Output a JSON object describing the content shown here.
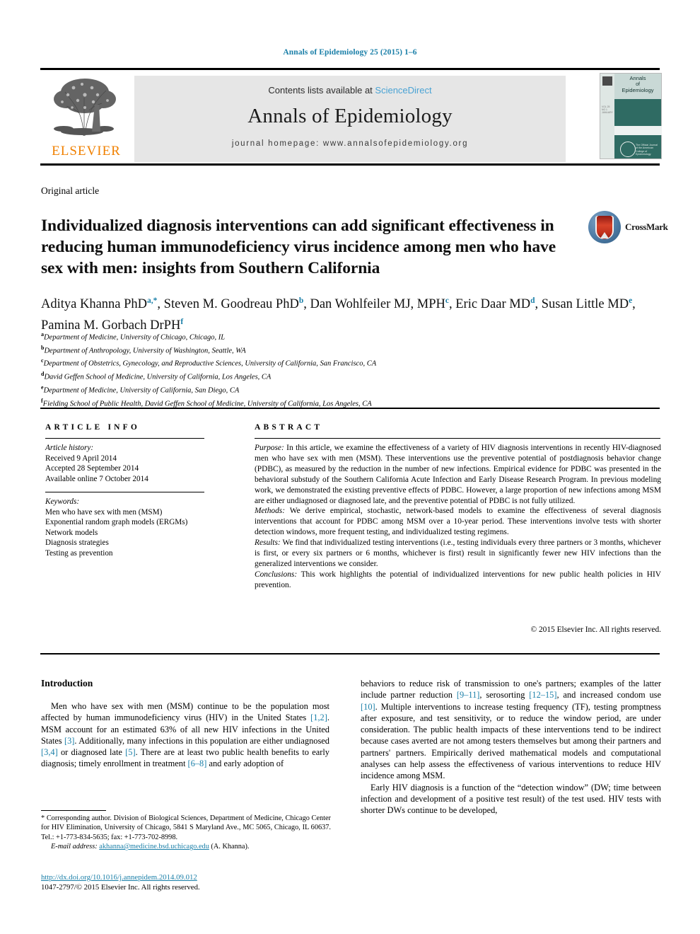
{
  "running_head": "Annals of Epidemiology 25 (2015) 1–6",
  "masthead": {
    "contents_prefix": "Contents lists available at ",
    "sciencedirect": "ScienceDirect",
    "journal_name": "Annals of Epidemiology",
    "homepage": "journal homepage: www.annalsofepidemiology.org",
    "publisher_logo_text": "ELSEVIER",
    "accent_color": "#4aa3d4",
    "logo_color": "#f08000"
  },
  "cover": {
    "line1": "Annals",
    "line2": "of",
    "line3": "Epidemiology",
    "sub": "Official Journal of the American College of Epidemiology",
    "seal_text": "The Official Journal of the American College of Epidemiology",
    "side_text": "VOL 25 NO 1 JANUARY",
    "band_color": "#2f6b63"
  },
  "article_type": "Original article",
  "title": "Individualized diagnosis interventions can add significant effectiveness in reducing human immunodeficiency virus incidence among men who have sex with men: insights from Southern California",
  "crossmark_label": "CrossMark",
  "authors": [
    {
      "name": "Aditya Khanna PhD",
      "marks": "a,*",
      "sep": ", "
    },
    {
      "name": "Steven M. Goodreau PhD",
      "marks": "b",
      "sep": ", "
    },
    {
      "name": "Dan Wohlfeiler MJ, MPH",
      "marks": "c",
      "sep": ", "
    },
    {
      "name": "Eric Daar MD",
      "marks": "d",
      "sep": ", "
    },
    {
      "name": "Susan Little MD",
      "marks": "e",
      "sep": ", "
    },
    {
      "name": "Pamina M. Gorbach DrPH",
      "marks": "f",
      "sep": ""
    }
  ],
  "affiliations": [
    {
      "mark": "a",
      "text": "Department of Medicine, University of Chicago, Chicago, IL"
    },
    {
      "mark": "b",
      "text": "Department of Anthropology, University of Washington, Seattle, WA"
    },
    {
      "mark": "c",
      "text": "Department of Obstetrics, Gynecology, and Reproductive Sciences, University of California, San Francisco, CA"
    },
    {
      "mark": "d",
      "text": "David Geffen School of Medicine, University of California, Los Angeles, CA"
    },
    {
      "mark": "e",
      "text": "Department of Medicine, University of California, San Diego, CA"
    },
    {
      "mark": "f",
      "text": "Fielding School of Public Health, David Geffen School of Medicine, University of California, Los Angeles, CA"
    }
  ],
  "article_info": {
    "heading": "ARTICLE INFO",
    "history_label": "Article history:",
    "history": [
      "Received 9 April 2014",
      "Accepted 28 September 2014",
      "Available online 7 October 2014"
    ],
    "keywords_label": "Keywords:",
    "keywords": [
      "Men who have sex with men (MSM)",
      "Exponential random graph models (ERGMs)",
      "Network models",
      "Diagnosis strategies",
      "Testing as prevention"
    ]
  },
  "abstract": {
    "heading": "ABSTRACT",
    "sections": [
      {
        "label": "Purpose:",
        "text": " In this article, we examine the effectiveness of a variety of HIV diagnosis interventions in recently HIV-diagnosed men who have sex with men (MSM). These interventions use the preventive potential of postdiagnosis behavior change (PDBC), as measured by the reduction in the number of new infections. Empirical evidence for PDBC was presented in the behavioral substudy of the Southern California Acute Infection and Early Disease Research Program. In previous modeling work, we demonstrated the existing preventive effects of PDBC. However, a large proportion of new infections among MSM are either undiagnosed or diagnosed late, and the preventive potential of PDBC is not fully utilized."
      },
      {
        "label": "Methods:",
        "text": " We derive empirical, stochastic, network-based models to examine the effectiveness of several diagnosis interventions that account for PDBC among MSM over a 10-year period. These interventions involve tests with shorter detection windows, more frequent testing, and individualized testing regimens."
      },
      {
        "label": "Results:",
        "text": " We find that individualized testing interventions (i.e., testing individuals every three partners or 3 months, whichever is first, or every six partners or 6 months, whichever is first) result in significantly fewer new HIV infections than the generalized interventions we consider."
      },
      {
        "label": "Conclusions:",
        "text": " This work highlights the potential of individualized interventions for new public health policies in HIV prevention."
      }
    ],
    "copyright": "© 2015 Elsevier Inc. All rights reserved."
  },
  "body": {
    "intro_heading": "Introduction",
    "left_paragraph_1_pre": "Men who have sex with men (MSM) continue to be the population most affected by human immunodeficiency virus (HIV) in the United States ",
    "left_refs": [
      "[1,2]",
      "[3]",
      "[3,4]",
      "[5]",
      "[6–8]"
    ],
    "right_refs": [
      "[9–11]",
      "[12–15]",
      "[10]"
    ],
    "left_parts": [
      "Men who have sex with men (MSM) continue to be the population most affected by human immunodeficiency virus (HIV) in the United States ",
      ". MSM account for an estimated 63% of all new HIV infections in the United States ",
      ". Additionally, many infections in this population are either undiagnosed ",
      " or diagnosed late ",
      ". There are at least two public health benefits to early diagnosis; timely enrollment in treatment ",
      " and early adoption of"
    ],
    "right_parts": [
      "behaviors to reduce risk of transmission to one's partners; examples of the latter include partner reduction ",
      ", serosorting ",
      ", and increased condom use ",
      ". Multiple interventions to increase testing frequency (TF), testing promptness after exposure, and test sensitivity, or to reduce the window period, are under consideration. The public health impacts of these interventions tend to be indirect because cases averted are not among testers themselves but among their partners and partners' partners. Empirically derived mathematical models and computational analyses can help assess the effectiveness of various interventions to reduce HIV incidence among MSM."
    ],
    "right_paragraph_2": "Early HIV diagnosis is a function of the “detection window” (DW; time between infection and development of a positive test result) of the test used. HIV tests with shorter DWs continue to be developed,"
  },
  "footnote": {
    "star_text": "* Corresponding author. Division of Biological Sciences, Department of Medicine, Chicago Center for HIV Elimination, University of Chicago, 5841 S Maryland Ave., MC 5065, Chicago, IL 60637. Tel.: +1-773-834-5635; fax: +1-773-702-8998.",
    "email_label": "E-mail address:",
    "email": "akhanna@medicine.bsd.uchicago.edu",
    "email_suffix": " (A. Khanna)."
  },
  "doi": {
    "url": "http://dx.doi.org/10.1016/j.annepidem.2014.09.012",
    "issn_line": "1047-2797/© 2015 Elsevier Inc. All rights reserved."
  }
}
